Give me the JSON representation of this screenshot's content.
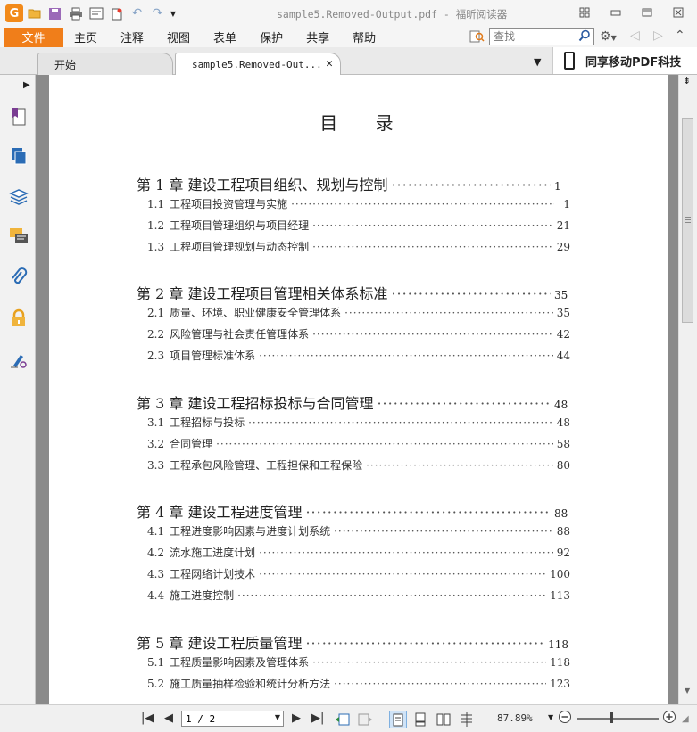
{
  "window": {
    "title": "sample5.Removed-Output.pdf - 福昕阅读器",
    "logo_letter": "G"
  },
  "menu": {
    "file": "文件",
    "items": [
      "主页",
      "注释",
      "视图",
      "表单",
      "保护",
      "共享",
      "帮助"
    ]
  },
  "search": {
    "placeholder": "查找"
  },
  "tabs": {
    "start": "开始",
    "document": "sample5.Removed-Out..."
  },
  "promo": {
    "text": "同享移动PDF科技"
  },
  "document": {
    "toc_title": "目 录",
    "chapters": [
      {
        "label": "第 1 章  建设工程项目组织、规划与控制",
        "page": "1",
        "sections": [
          {
            "num": "1.1",
            "title": "工程项目投资管理与实施",
            "page": "1"
          },
          {
            "num": "1.2",
            "title": "工程项目管理组织与项目经理",
            "page": "21"
          },
          {
            "num": "1.3",
            "title": "工程项目管理规划与动态控制",
            "page": "29"
          }
        ]
      },
      {
        "label": "第 2 章  建设工程项目管理相关体系标准",
        "page": "35",
        "sections": [
          {
            "num": "2.1",
            "title": "质量、环境、职业健康安全管理体系",
            "page": "35"
          },
          {
            "num": "2.2",
            "title": "风险管理与社会责任管理体系",
            "page": "42"
          },
          {
            "num": "2.3",
            "title": "项目管理标准体系",
            "page": "44"
          }
        ]
      },
      {
        "label": "第 3 章  建设工程招标投标与合同管理",
        "page": "48",
        "sections": [
          {
            "num": "3.1",
            "title": "工程招标与投标",
            "page": "48"
          },
          {
            "num": "3.2",
            "title": "合同管理",
            "page": "58"
          },
          {
            "num": "3.3",
            "title": "工程承包风险管理、工程担保和工程保险",
            "page": "80"
          }
        ]
      },
      {
        "label": "第 4 章  建设工程进度管理",
        "page": "88",
        "sections": [
          {
            "num": "4.1",
            "title": "工程进度影响因素与进度计划系统",
            "page": "88"
          },
          {
            "num": "4.2",
            "title": "流水施工进度计划",
            "page": "92"
          },
          {
            "num": "4.3",
            "title": "工程网络计划技术",
            "page": "100"
          },
          {
            "num": "4.4",
            "title": "施工进度控制",
            "page": "113"
          }
        ]
      },
      {
        "label": "第 5 章  建设工程质量管理",
        "page": "118",
        "sections": [
          {
            "num": "5.1",
            "title": "工程质量影响因素及管理体系",
            "page": "118"
          },
          {
            "num": "5.2",
            "title": "施工质量抽样检验和统计分析方法",
            "page": "123"
          }
        ]
      }
    ]
  },
  "status": {
    "page_value": "1 / 2",
    "zoom": "87.89%"
  },
  "colors": {
    "accent": "#f07e1a",
    "sidebar_icons": "#2b6cb5",
    "doc_background": "#8a8a8a"
  }
}
